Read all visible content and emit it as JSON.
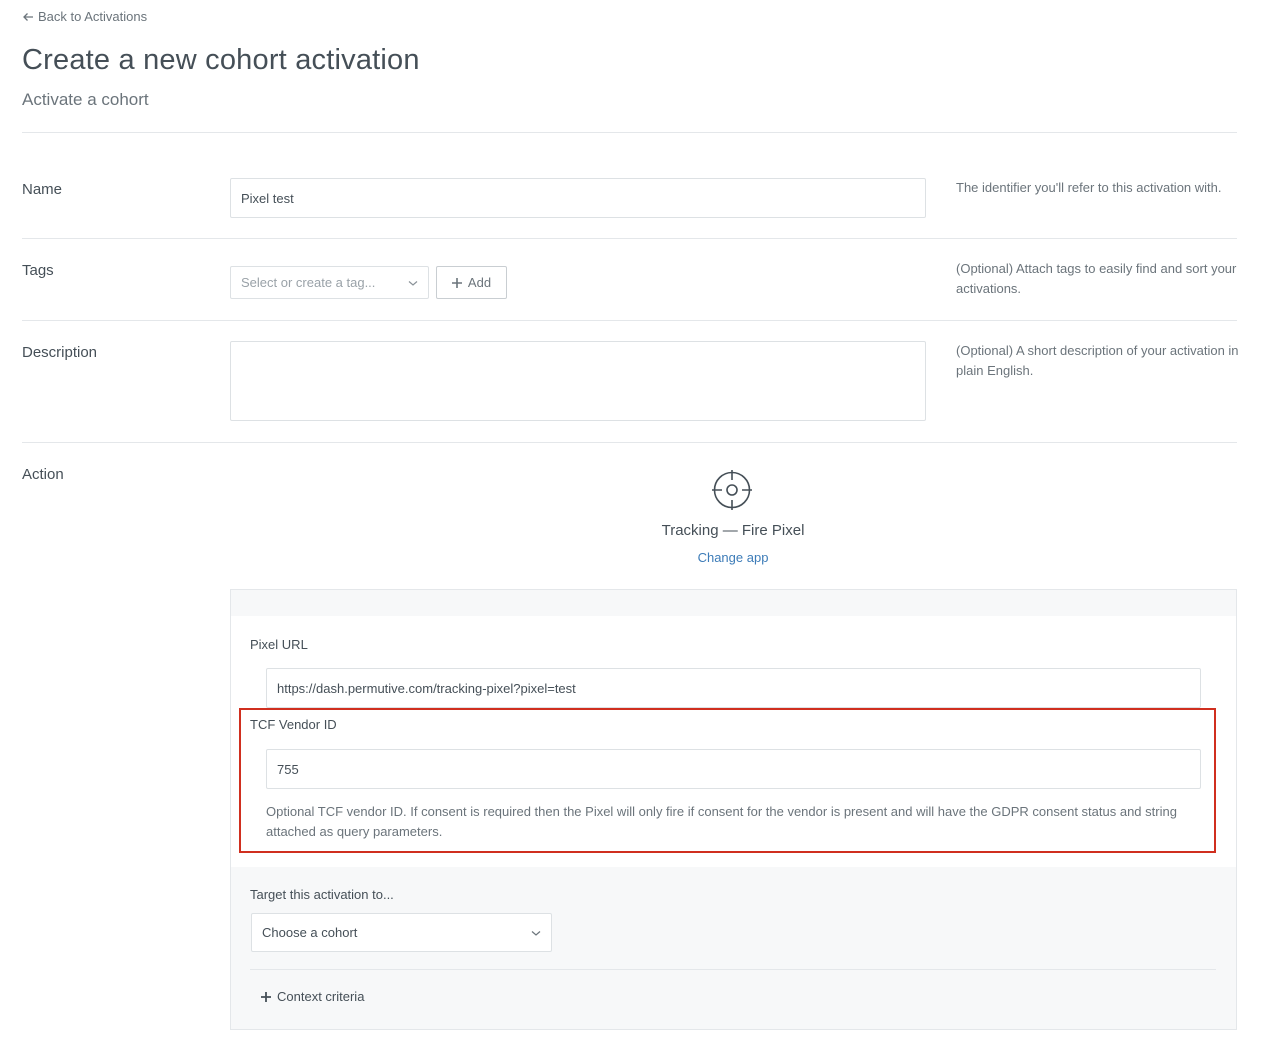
{
  "nav": {
    "back_label": "Back to Activations"
  },
  "header": {
    "title": "Create a new cohort activation",
    "subtitle": "Activate a cohort"
  },
  "form": {
    "name": {
      "label": "Name",
      "value": "Pixel test",
      "help": "The identifier you'll refer to this activation with."
    },
    "tags": {
      "label": "Tags",
      "placeholder": "Select or create a tag...",
      "add_label": "Add",
      "help": "(Optional) Attach tags to easily find and sort your activations."
    },
    "description": {
      "label": "Description",
      "value": "",
      "help": "(Optional) A short description of your activation in plain English."
    },
    "action": {
      "label": "Action",
      "app_icon": "crosshair-icon",
      "app_name": "Tracking — Fire Pixel",
      "change_app_label": "Change app",
      "pixel_url": {
        "label": "Pixel URL",
        "value": "https://dash.permutive.com/tracking-pixel?pixel=test"
      },
      "tcf_vendor": {
        "label": "TCF Vendor ID",
        "value": "755",
        "help": "Optional TCF vendor ID. If consent is required then the Pixel will only fire if consent for the vendor is present and will have the GDPR consent status and string attached as query parameters."
      },
      "target": {
        "label": "Target this activation to...",
        "select_value": "Choose a cohort"
      },
      "context_label": "Context criteria"
    }
  },
  "colors": {
    "link": "#3d7cb8",
    "highlight": "#d02f1f",
    "text": "#454f57"
  }
}
